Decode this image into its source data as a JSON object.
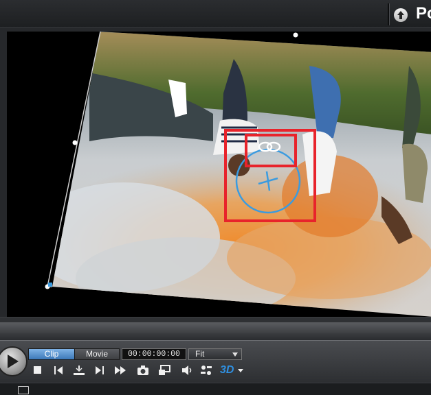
{
  "header": {
    "upload_icon": "up-arrow-icon",
    "truncated_label": "Po"
  },
  "viewer": {
    "overlay_color": "#e8232b",
    "rotation_handle_color": "#3a9be0"
  },
  "playback": {
    "tabs": [
      {
        "label": "Clip",
        "active": true
      },
      {
        "label": "Movie",
        "active": false
      }
    ],
    "timecode": "00:00:00:00",
    "zoom_select": "Fit",
    "buttons": [
      "stop-icon",
      "previous-frame-icon",
      "split-icon",
      "next-frame-icon",
      "fast-forward-icon",
      "snapshot-icon",
      "preview-quality-icon",
      "volume-icon",
      "settings-icon",
      "3d-icon"
    ],
    "three_d_label": "3D"
  },
  "colors": {
    "accent": "#3c78b8",
    "background": "#1b1d1f"
  }
}
